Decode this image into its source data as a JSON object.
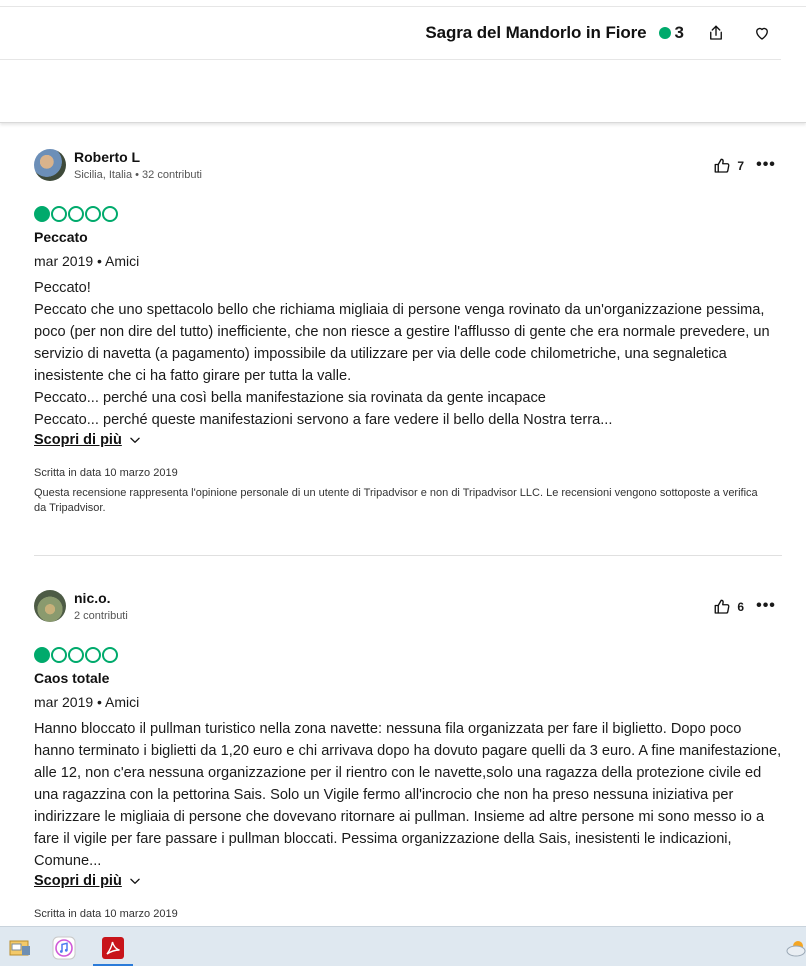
{
  "header": {
    "title": "Sagra del Mandorlo in Fiore",
    "rating_count": "3"
  },
  "reviews": [
    {
      "user_name": "Roberto L",
      "user_meta": "Sicilia, Italia • 32 contributi",
      "helpful_count": "7",
      "rating": 1,
      "title": "Peccato",
      "date": "mar 2019 • Amici",
      "body": "Peccato!\nPeccato che uno spettacolo bello che richiama migliaia di persone venga rovinato da un'organizzazione pessima, poco (per non dire del tutto) inefficiente, che non riesce a gestire l'afflusso di gente che era normale prevedere, un servizio di navetta (a pagamento) impossibile da utilizzare per via delle code chilometriche, una segnaletica inesistente che ci ha fatto girare per tutta la valle.\nPeccato... perché una così bella manifestazione sia rovinata da gente incapace\nPeccato... perché queste manifestazioni servono a fare vedere il bello della Nostra terra...",
      "read_more": "Scopri di più",
      "written_date": "Scritta in data 10 marzo 2019",
      "disclaimer": "Questa recensione rappresenta l'opinione personale di un utente di Tripadvisor e non di Tripadvisor LLC. Le recensioni vengono sottoposte a verifica da Tripadvisor."
    },
    {
      "user_name": "nic.o.",
      "user_meta": "2 contributi",
      "helpful_count": "6",
      "rating": 1,
      "title": "Caos totale",
      "date": "mar 2019 • Amici",
      "body": "Hanno bloccato il pullman turistico nella zona navette: nessuna fila organizzata per fare il biglietto. Dopo poco hanno terminato i biglietti da 1,20 euro e chi arrivava dopo ha dovuto pagare quelli da 3 euro. A fine manifestazione, alle 12, non c'era nessuna organizzazione per il rientro con le navette,solo una ragazza della protezione civile ed una ragazzina con la pettorina Sais. Solo un Vigile fermo all'incrocio che non ha preso nessuna iniziativa per indirizzare le migliaia di persone che dovevano ritornare ai pullman. Insieme ad altre persone mi sono messo io a fare il vigile per fare passare i pullman bloccati. Pessima organizzazione della Sais, inesistenti le indicazioni, Comune...",
      "read_more": "Scopri di più",
      "written_date": "Scritta in data 10 marzo 2019"
    }
  ],
  "colors": {
    "accent_green": "#00aa6c",
    "taskbar": "#dfe8f0"
  },
  "taskbar": {
    "items": [
      "file-explorer-icon",
      "itunes-icon",
      "acrobat-icon",
      "weather-icon"
    ]
  }
}
